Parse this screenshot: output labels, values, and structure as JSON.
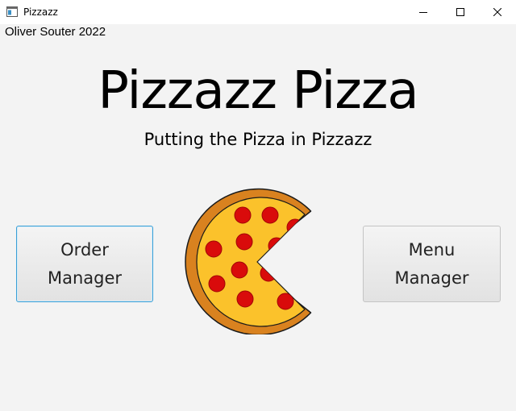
{
  "window": {
    "title": "Pizzazz",
    "controls": [
      "minimize-icon",
      "maximize-icon",
      "close-icon"
    ]
  },
  "content": {
    "author": "Oliver Souter 2022",
    "title": "Pizzazz Pizza",
    "subtitle": "Putting the Pizza in Pizzazz",
    "order_button": {
      "line1": "Order",
      "line2": "Manager"
    },
    "menu_button": {
      "line1": "Menu",
      "line2": "Manager"
    },
    "illustration": "pizza-icon"
  },
  "colors": {
    "background": "#f3f3f3",
    "crust": "#d9821f",
    "cheese": "#fbc22b",
    "pepperoni": "#d90b0b",
    "focus_border": "#3a9fd6"
  }
}
